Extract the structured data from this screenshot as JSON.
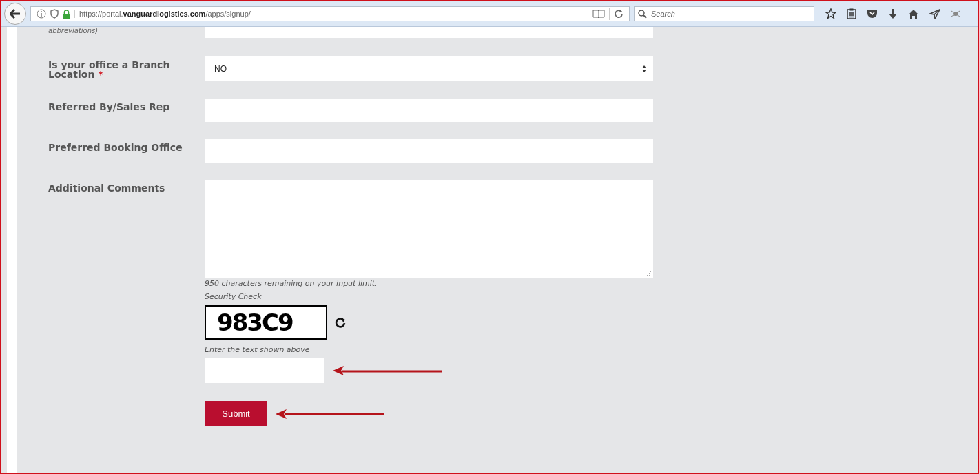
{
  "browser": {
    "url_prefix": "https://portal.",
    "url_domain": "vanguardlogistics.com",
    "url_path": "/apps/signup/",
    "search": {
      "placeholder": "Search"
    }
  },
  "form": {
    "cut_label": "abbreviations)",
    "fields": [
      {
        "kind": "select",
        "label": "Is your office a Branch Location",
        "required_mark": "*",
        "value": "NO"
      },
      {
        "kind": "text",
        "label": "Referred By/Sales Rep"
      },
      {
        "kind": "text",
        "label": "Preferred Booking Office"
      },
      {
        "kind": "textarea",
        "label": "Additional Comments"
      }
    ],
    "remaining": "950 characters remaining on your input limit.",
    "security_label": "Security Check",
    "captcha": "983C9",
    "captcha_hint": "Enter the text shown above",
    "submit": "Submit"
  }
}
